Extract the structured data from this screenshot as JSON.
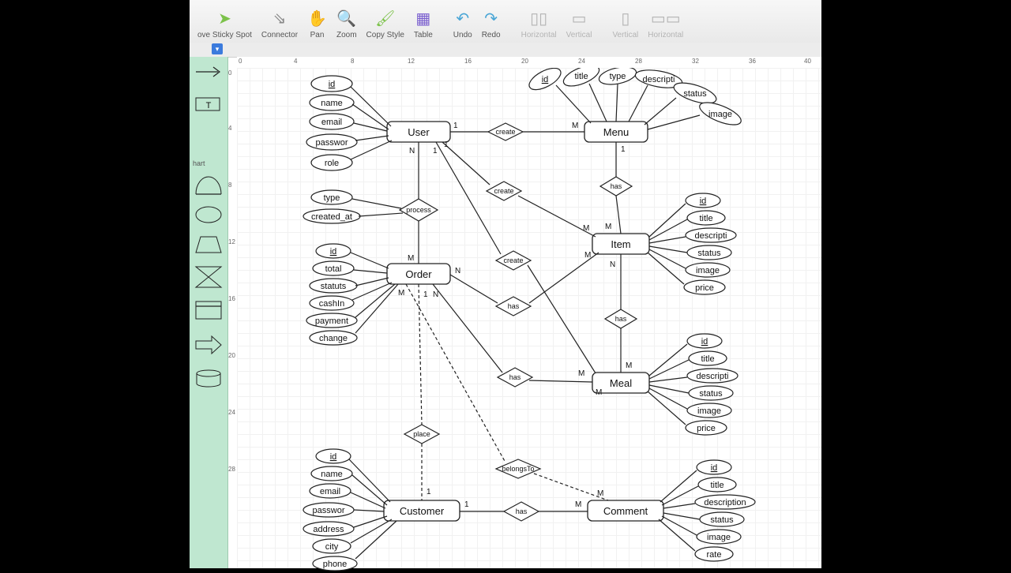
{
  "toolbar": {
    "move": {
      "label": "ove Sticky Spot"
    },
    "connector": {
      "label": "Connector"
    },
    "pan": {
      "label": "Pan"
    },
    "zoom": {
      "label": "Zoom"
    },
    "copystyle": {
      "label": "Copy Style"
    },
    "table": {
      "label": "Table"
    },
    "undo": {
      "label": "Undo"
    },
    "redo": {
      "label": "Redo"
    },
    "alignA": {
      "l1": "Horizontal",
      "l2": "Vertical"
    },
    "alignB": {
      "l1": "Vertical",
      "l2": "Horizontal"
    }
  },
  "stencil": {
    "label": "hart"
  },
  "ruler": {
    "h": [
      "0",
      "4",
      "8",
      "12",
      "16",
      "20",
      "24",
      "28",
      "32",
      "36",
      "40"
    ],
    "v": [
      "0",
      "4",
      "8",
      "12",
      "16",
      "20",
      "24",
      "28"
    ]
  },
  "entities": {
    "user": {
      "label": "User",
      "attrs": [
        "id",
        "name",
        "email",
        "passwor",
        "role"
      ]
    },
    "menu": {
      "label": "Menu",
      "attrs": [
        "id",
        "title",
        "type",
        "descripti",
        "status",
        "image"
      ]
    },
    "item": {
      "label": "Item",
      "attrs": [
        "id",
        "title",
        "descripti",
        "status",
        "image",
        "price"
      ]
    },
    "order": {
      "label": "Order",
      "attrs": [
        "id",
        "total",
        "statuts",
        "cashIn",
        "payment",
        "change"
      ]
    },
    "meal": {
      "label": "Meal",
      "attrs": [
        "id",
        "title",
        "descripti",
        "status",
        "image",
        "price"
      ]
    },
    "customer": {
      "label": "Customer",
      "attrs": [
        "id",
        "name",
        "email",
        "passwor",
        "address",
        "city",
        "phone"
      ]
    },
    "comment": {
      "label": "Comment",
      "attrs": [
        "id",
        "title",
        "description",
        "status",
        "image",
        "rate"
      ]
    },
    "process": {
      "attrs": [
        "type",
        "created_at"
      ]
    }
  },
  "relations": {
    "create": "create",
    "has": "has",
    "process": "process",
    "place": "place",
    "belongsTo": "belongsTo"
  },
  "card": {
    "one": "1",
    "M": "M",
    "N": "N"
  }
}
